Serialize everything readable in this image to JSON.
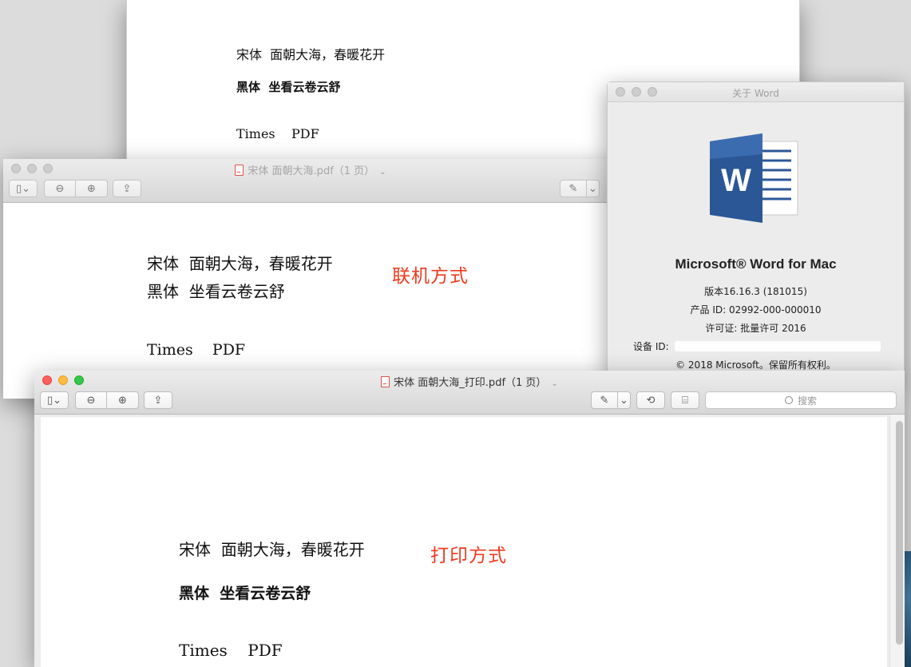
{
  "word_doc": {
    "line1": "宋体  面朝大海，春暖花开",
    "line2": "黑体  坐看云卷云舒",
    "line3": "Times    PDF"
  },
  "pdf_online": {
    "title": "宋体 面朝大海.pdf（1 页）",
    "line1": "宋体  面朝大海，春暖花开",
    "line2": "黑体  坐看云卷云舒",
    "line3": "Times    PDF",
    "annotation": "联机方式"
  },
  "about_word": {
    "window_title": "关于 Word",
    "product": "Microsoft® Word for Mac",
    "version": "版本16.16.3 (181015)",
    "product_id": "产品 ID: 02992-000-000010",
    "license": "许可证: 批量许可 2016",
    "device_id_label": "设备 ID: ",
    "copyright": "© 2018 Microsoft。保留所有权利。",
    "logo_letter": "W",
    "brand_color": "#2b5797"
  },
  "pdf_print": {
    "title": "宋体 面朝大海_打印.pdf（1 页）",
    "search_placeholder": "搜索",
    "line1": "宋体  面朝大海，春暖花开",
    "line2": "黑体  坐看云卷云舒",
    "line3": "Times    PDF",
    "annotation": "打印方式"
  },
  "icons": {
    "sidebar": "sidebar-icon",
    "zoom_out": "zoom-out-icon",
    "zoom_in": "zoom-in-icon",
    "share": "share-icon",
    "markup": "markup-pen-icon",
    "rotate": "rotate-icon",
    "toolbox": "toolbox-icon",
    "search": "search-icon"
  }
}
